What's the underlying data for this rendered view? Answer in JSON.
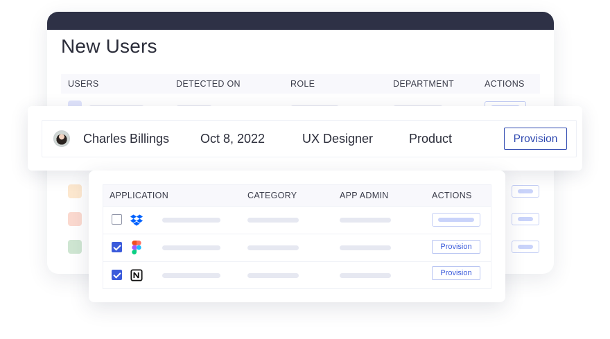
{
  "users_panel": {
    "title": "New Users",
    "columns": [
      "USERS",
      "DETECTED ON",
      "ROLE",
      "DEPARTMENT",
      "ACTIONS"
    ],
    "row_colors": [
      "#dfe3fb",
      "#fde8cf",
      "#fbd9cf",
      "#cfe6d2"
    ]
  },
  "highlighted_user": {
    "name": "Charles Billings",
    "detected_on": "Oct 8, 2022",
    "role": "UX Designer",
    "department": "Product",
    "action_label": "Provision"
  },
  "applications_panel": {
    "columns": [
      "APPLICATION",
      "CATEGORY",
      "APP ADMIN",
      "ACTIONS"
    ],
    "rows": [
      {
        "icon": "dropbox-icon",
        "checked": false,
        "action_label": ""
      },
      {
        "icon": "figma-icon",
        "checked": true,
        "action_label": "Provision"
      },
      {
        "icon": "notion-icon",
        "checked": true,
        "action_label": "Provision"
      }
    ]
  },
  "colors": {
    "header_bar": "#2e3146",
    "accent": "#2f49b0",
    "checkbox": "#3b5bdb"
  }
}
